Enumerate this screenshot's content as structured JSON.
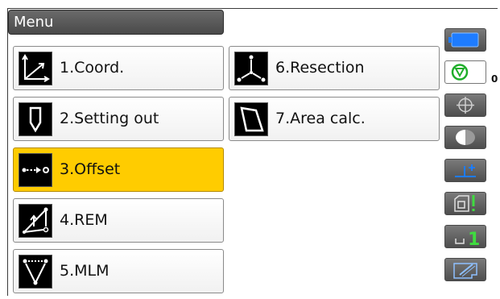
{
  "title": "Menu",
  "menu": {
    "items": [
      {
        "label": "1.Coord.",
        "icon": "coordinate-axes-icon",
        "selected": false
      },
      {
        "label": "2.Setting out",
        "icon": "stake-out-icon",
        "selected": false
      },
      {
        "label": "3.Offset",
        "icon": "offset-icon",
        "selected": true
      },
      {
        "label": "4.REM",
        "icon": "rem-icon",
        "selected": false
      },
      {
        "label": "5.MLM",
        "icon": "mlm-icon",
        "selected": false
      },
      {
        "label": "6.Resection",
        "icon": "resection-icon",
        "selected": false
      },
      {
        "label": "7.Area calc.",
        "icon": "area-calc-icon",
        "selected": false
      }
    ]
  },
  "status": {
    "battery_icon": "battery-icon",
    "target_icon": "prism-target-icon",
    "prism_constant": "0",
    "laser_icon": "laser-plummet-icon",
    "tilt_icon": "tilt-half-icon",
    "input_mode_icon": "input-mode-icon",
    "record_icon": "record-icon",
    "softkey_page_icon": "softkey-page-icon",
    "softkey_page": "1",
    "edit_icon": "edit-icon"
  },
  "colors": {
    "selected": "#ffcc00",
    "status_accent_blue": "#1e7cff",
    "status_accent_green": "#3fdc3f"
  }
}
